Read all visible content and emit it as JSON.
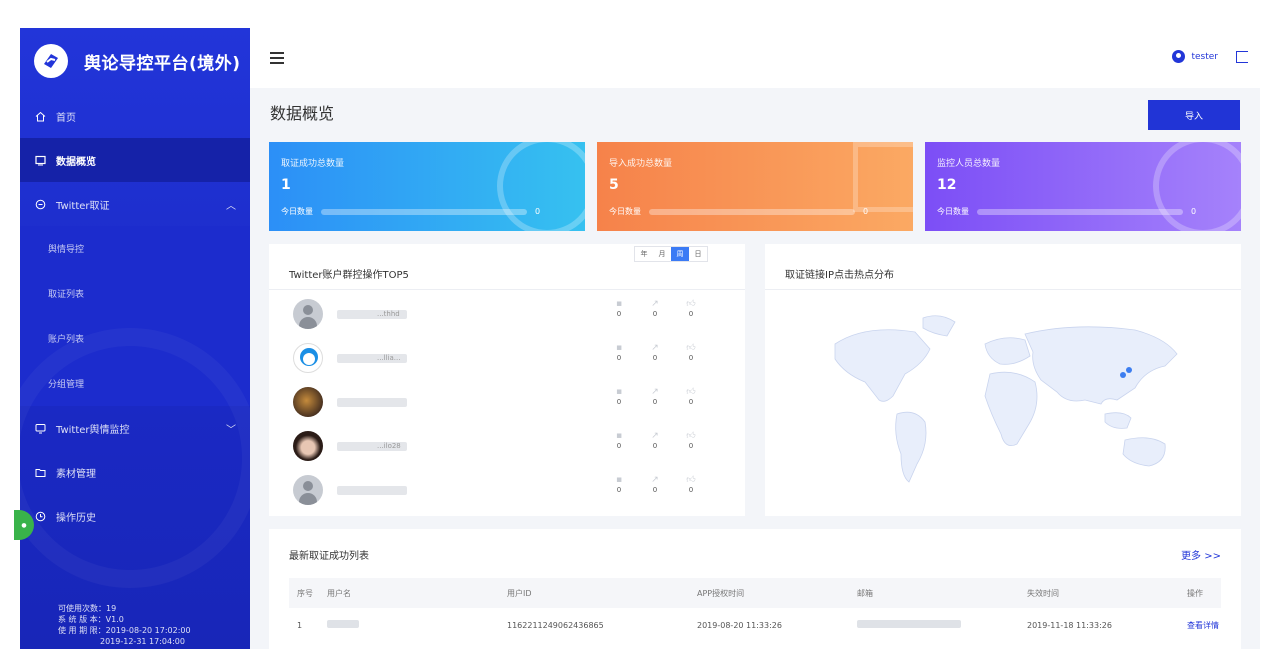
{
  "app": {
    "title": "舆论导控平台(境外)",
    "user": "tester",
    "accent": "#2236d8"
  },
  "sidebar": {
    "items": [
      {
        "label": "首页",
        "icon": "home-icon"
      },
      {
        "label": "数据概览",
        "icon": "dashboard-icon",
        "active": true
      },
      {
        "label": "Twitter取证",
        "icon": "twitter-icon",
        "expanded": true
      },
      {
        "label": "Twitter舆情监控",
        "icon": "monitor-icon"
      },
      {
        "label": "素材管理",
        "icon": "folder-icon"
      },
      {
        "label": "操作历史",
        "icon": "history-icon"
      }
    ],
    "sub_items": [
      "舆情导控",
      "取证列表",
      "账户列表",
      "分组管理"
    ],
    "info": {
      "usage": "可使用次数：19",
      "version": "系 统 版 本：V1.0",
      "period_start": "使 用 期 限：2019-08-20 17:02:00",
      "period_end": "2019-12-31 17:04:00"
    }
  },
  "page": {
    "title": "数据概览",
    "import_label": "导入"
  },
  "stats": [
    {
      "label": "取证成功总数量",
      "value": "1",
      "today_label": "今日数量",
      "today_value": "0",
      "color_from": "#2c8ff7",
      "color_to": "#36c1f0"
    },
    {
      "label": "导入成功总数量",
      "value": "5",
      "today_label": "今日数量",
      "today_value": "0",
      "color_from": "#f6824a",
      "color_to": "#fba963"
    },
    {
      "label": "监控人员总数量",
      "value": "12",
      "today_label": "今日数量",
      "today_value": "0",
      "color_from": "#7c4ef6",
      "color_to": "#a582fb"
    }
  ],
  "top5": {
    "title": "Twitter账户群控操作TOP5",
    "periods": [
      "年",
      "月",
      "周",
      "日"
    ],
    "selected_period": "周",
    "rows": [
      {
        "avatar": "gray",
        "name": "...thhd",
        "comments": "0",
        "retweets": "0",
        "likes": "0"
      },
      {
        "avatar": "doraemon",
        "name": "...llia...",
        "comments": "0",
        "retweets": "0",
        "likes": "0"
      },
      {
        "avatar": "photo1",
        "name": "",
        "comments": "0",
        "retweets": "0",
        "likes": "0"
      },
      {
        "avatar": "photo2",
        "name": "...ilo28",
        "comments": "0",
        "retweets": "0",
        "likes": "0"
      },
      {
        "avatar": "gray",
        "name": "",
        "comments": "0",
        "retweets": "0",
        "likes": "0"
      }
    ]
  },
  "map_card": {
    "title": "取证链接IP点击热点分布"
  },
  "recent": {
    "title": "最新取证成功列表",
    "more": "更多 >>",
    "columns": [
      "序号",
      "用户名",
      "用户ID",
      "APP授权时间",
      "邮箱",
      "失效时间",
      "操作"
    ],
    "rows": [
      {
        "index": "1",
        "username": "",
        "user_id": "1162211249062436865",
        "auth_time": "2019-08-20 11:33:26",
        "email": "",
        "expire": "2019-11-18 11:33:26",
        "action": "查看详情"
      }
    ]
  }
}
